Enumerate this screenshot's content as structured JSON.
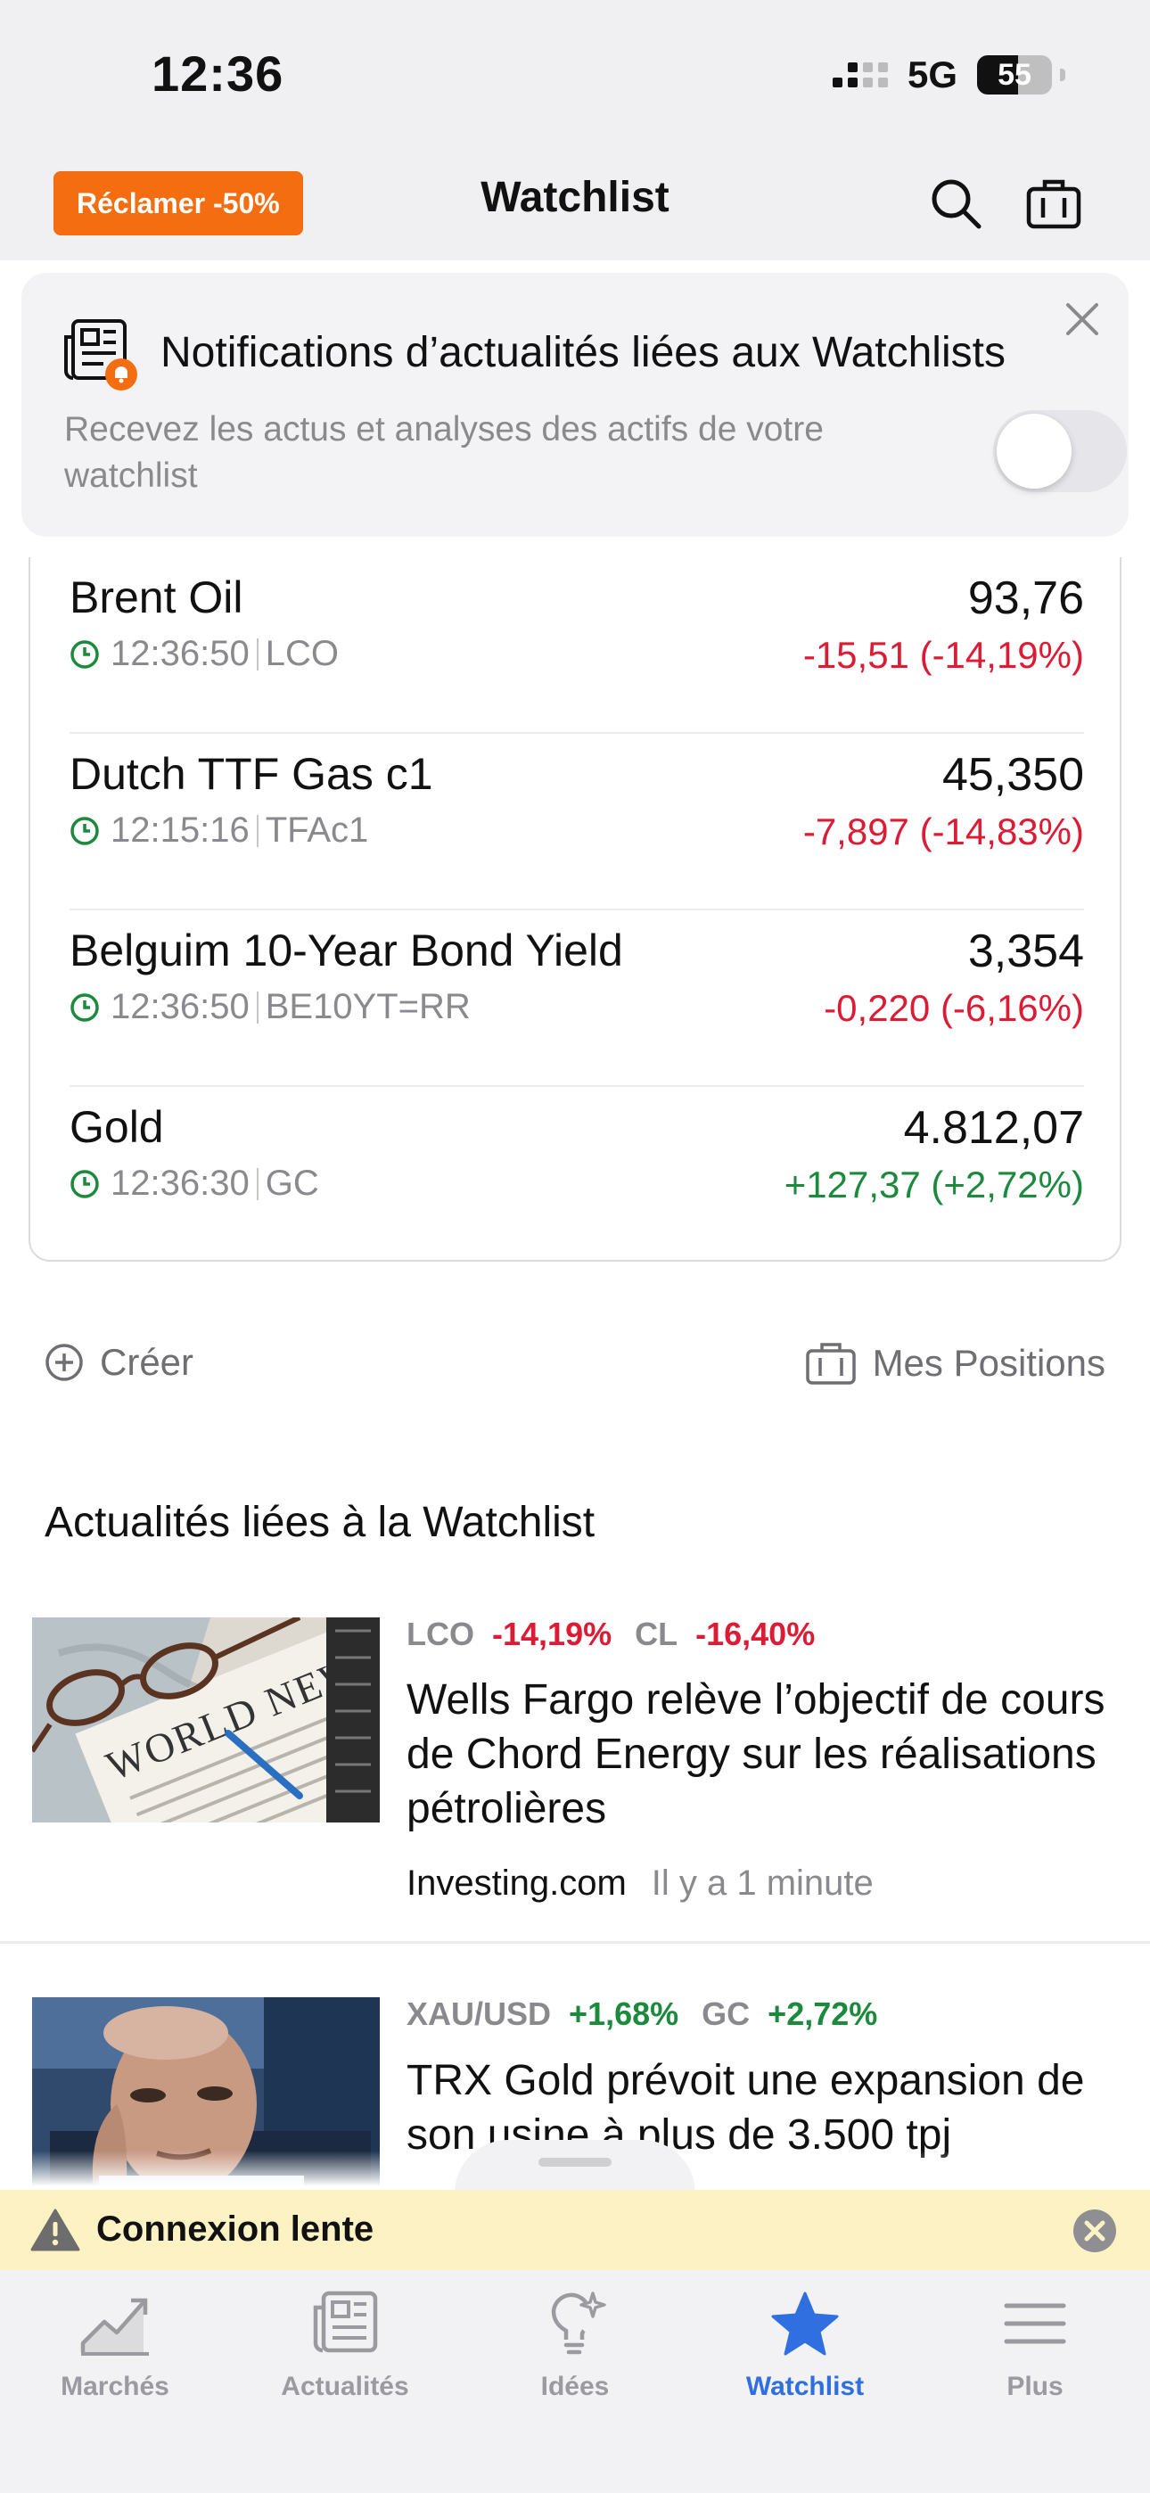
{
  "status_bar": {
    "time": "12:36",
    "network": "5G",
    "battery": "55"
  },
  "header": {
    "promo_label": "Réclamer -50%",
    "title": "Watchlist"
  },
  "notification": {
    "title": "Notifications d’actualités liées aux Watchlists",
    "subtitle": "Recevez les actus et analyses des actifs de votre watchlist",
    "toggle_on": false
  },
  "watchlist": [
    {
      "name": "Brent Oil",
      "time": "12:36:50",
      "symbol": "LCO",
      "price": "93,76",
      "change": "-15,51 (-14,19%)",
      "direction": "down"
    },
    {
      "name": "Dutch TTF Gas c1",
      "time": "12:15:16",
      "symbol": "TFAc1",
      "price": "45,350",
      "change": "-7,897 (-14,83%)",
      "direction": "down"
    },
    {
      "name": "Belguim 10-Year Bond Yield",
      "time": "12:36:50",
      "symbol": "BE10YT=RR",
      "price": "3,354",
      "change": "-0,220 (-6,16%)",
      "direction": "down"
    },
    {
      "name": "Gold",
      "time": "12:36:30",
      "symbol": "GC",
      "price": "4.812,07",
      "change": "+127,37 (+2,72%)",
      "direction": "up"
    }
  ],
  "actions": {
    "create_label": "Créer",
    "positions_label": "Mes Positions"
  },
  "news_section": {
    "title": "Actualités liées à la Watchlist",
    "items": [
      {
        "tags": [
          {
            "symbol": "LCO",
            "change": "-14,19%"
          },
          {
            "symbol": "CL",
            "change": "-16,40%"
          }
        ],
        "headline": "Wells Fargo relève l’objectif de cours de Chord Energy sur les réalisations pétrolières",
        "source": "Investing.com",
        "time_ago": "Il y a 1 minute",
        "image_text": "WORLD NEWS"
      },
      {
        "tags": [
          {
            "symbol": "XAU/USD",
            "change": "+1,68%"
          },
          {
            "symbol": "GC",
            "change": "+2,72%"
          }
        ],
        "headline": "TRX Gold prévoit une expansion de son usine à plus de 3.500 tpj"
      }
    ]
  },
  "slow_connection": {
    "label": "Connexion lente"
  },
  "tabs": [
    {
      "label": "Marchés",
      "icon": "chart-line-icon"
    },
    {
      "label": "Actualités",
      "icon": "newspaper-icon"
    },
    {
      "label": "Idées",
      "icon": "lightbulb-icon"
    },
    {
      "label": "Watchlist",
      "icon": "star-icon",
      "active": true
    },
    {
      "label": "Plus",
      "icon": "menu-icon"
    }
  ],
  "colors": {
    "promo": "#f46d10",
    "negative": "#dc1b34",
    "positive": "#1b8a3c",
    "active_tab": "#2f6fe0",
    "slow_banner": "#fdf2c4"
  }
}
